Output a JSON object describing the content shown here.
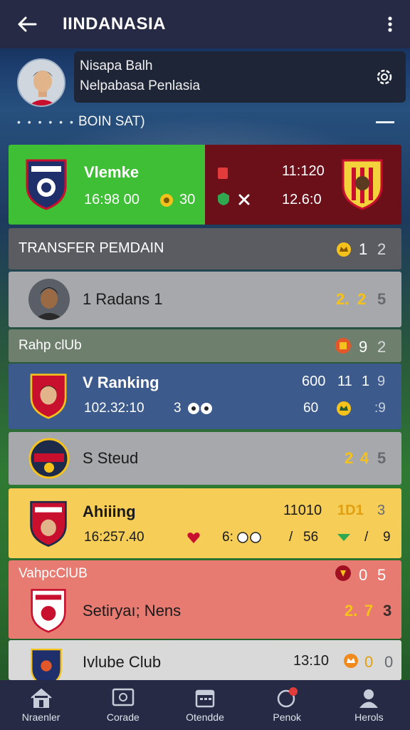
{
  "header": {
    "title": "IINDANASIA",
    "back_icon": "back-arrow-icon",
    "more_icon": "more-vertical-icon"
  },
  "profile": {
    "line1": "Nisapa Balh",
    "line2": "Nelpabasa Penlasia",
    "status_dots": "• • • • • •",
    "status_label": "BOIN SAT)"
  },
  "match": {
    "home_name": "Vlemke",
    "home_time": "16:98 00",
    "home_stat": "30",
    "away_time": "11:120",
    "away_score": "12.6:0",
    "colors": {
      "home": "#3fbf35",
      "away": "#6b0f19"
    }
  },
  "transfer": {
    "title": "TRANSFER PEMDAIN",
    "n1": "1",
    "n2": "2",
    "player_label": "1  Radans 1",
    "p1": "2.",
    "p2": "2",
    "p3": "5"
  },
  "rank_club": {
    "title": "Rahp clUb",
    "n1": "9",
    "n2": "2",
    "row1_name": "V Ranking",
    "row1_time": "102.32:10",
    "row1_extra": "3",
    "row1_val1": "600",
    "row1_a": "11",
    "row1_b": "1",
    "row1_c": "9",
    "row1_val2": "60",
    "row1_d": ":9",
    "row2_name": "S  Steud",
    "row2_a": "2",
    "row2_b": "4",
    "row2_c": "5"
  },
  "aihiing": {
    "name": "Ahiiing",
    "time": "16:257.40",
    "val_a": "11010",
    "val_b": "1D1",
    "val_c": "3",
    "mid": "6:",
    "slash1": "/",
    "v56": "56",
    "slash2": "/",
    "v9": "9"
  },
  "vahpc": {
    "title": "VahpcClUB",
    "n1": "0",
    "n2": "5",
    "row_name": "Setiryaı; Nens",
    "r1": "2.",
    "r2": "7",
    "r3": "3"
  },
  "mube": {
    "name": "Ivlube Club",
    "time": "13:10",
    "n1": "0",
    "n2": "0"
  },
  "nav": {
    "items": [
      {
        "label": "Nraenler",
        "icon": "home-icon"
      },
      {
        "label": "Corade",
        "icon": "media-icon"
      },
      {
        "label": "Otendde",
        "icon": "calendar-icon"
      },
      {
        "label": "Penok",
        "icon": "chat-icon",
        "badge": "!"
      },
      {
        "label": "Herols",
        "icon": "profile-icon"
      }
    ]
  }
}
